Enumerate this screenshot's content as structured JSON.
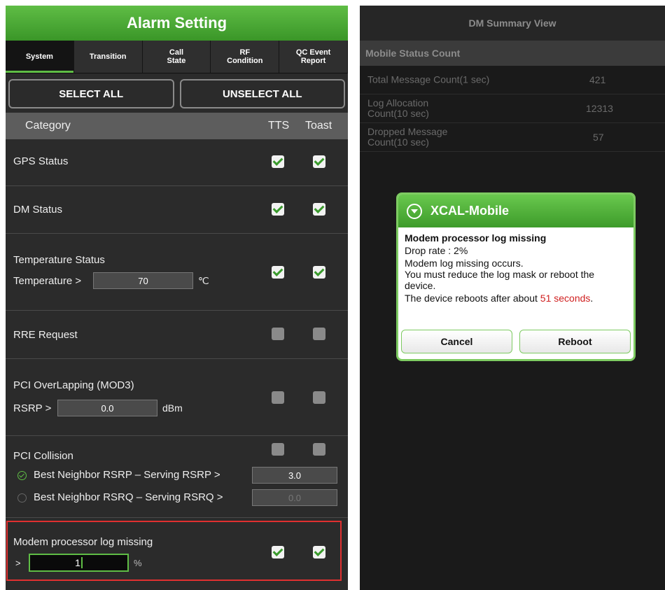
{
  "alarm_setting": {
    "title": "Alarm Setting",
    "tabs": [
      {
        "label": "System"
      },
      {
        "label": "Transition"
      },
      {
        "label": "Call\nState"
      },
      {
        "label": "RF\nCondition"
      },
      {
        "label": "QC Event\nReport"
      }
    ],
    "select_all": "SELECT ALL",
    "unselect_all": "UNSELECT ALL",
    "header": {
      "category": "Category",
      "tts": "TTS",
      "toast": "Toast"
    },
    "rows": {
      "gps": {
        "label": "GPS Status",
        "tts": true,
        "toast": true
      },
      "dm": {
        "label": "DM Status",
        "tts": true,
        "toast": true
      },
      "temperature": {
        "label": "Temperature Status",
        "sub_label": "Temperature >",
        "value": "70",
        "unit": "℃",
        "tts": true,
        "toast": true
      },
      "rre": {
        "label": "RRE Request",
        "tts": false,
        "toast": false
      },
      "pci_overlap": {
        "label": "PCI OverLapping (MOD3)",
        "sub_label": "RSRP >",
        "value": "0.0",
        "unit": "dBm",
        "tts": false,
        "toast": false
      },
      "pci_collision": {
        "label": "PCI Collision",
        "tts": false,
        "toast": false,
        "option1": {
          "label": "Best Neighbor RSRP – Serving RSRP >",
          "value": "3.0",
          "selected": true
        },
        "option2": {
          "label": "Best Neighbor RSRQ – Serving RSRQ >",
          "value": "0.0",
          "selected": false
        }
      },
      "modem": {
        "label": "Modem processor log missing",
        "sub_label": ">",
        "value": "1",
        "unit": "%",
        "tts": true,
        "toast": true
      }
    }
  },
  "dm_summary": {
    "title": "DM Summary View",
    "section": "Mobile Status Count",
    "rows": [
      {
        "label": "Total Message Count(1 sec)",
        "value": "421"
      },
      {
        "label": "Log Allocation\nCount(10 sec)",
        "value": "12313"
      },
      {
        "label": "Dropped Message\nCount(10 sec)",
        "value": "57"
      }
    ]
  },
  "dialog": {
    "title": "XCAL-Mobile",
    "heading": "Modem processor log missing",
    "drop_rate": "Drop rate : 2%",
    "line1": "Modem log missing occurs.",
    "line2": "You must reduce the log mask or reboot the device.",
    "reboot_prefix": "The device reboots after about ",
    "seconds": "51 seconds",
    "reboot_suffix": ".",
    "cancel": "Cancel",
    "reboot": "Reboot"
  },
  "colors": {
    "accent": "#5fbd45",
    "highlight": "#e03030",
    "countdown": "#d02020"
  }
}
